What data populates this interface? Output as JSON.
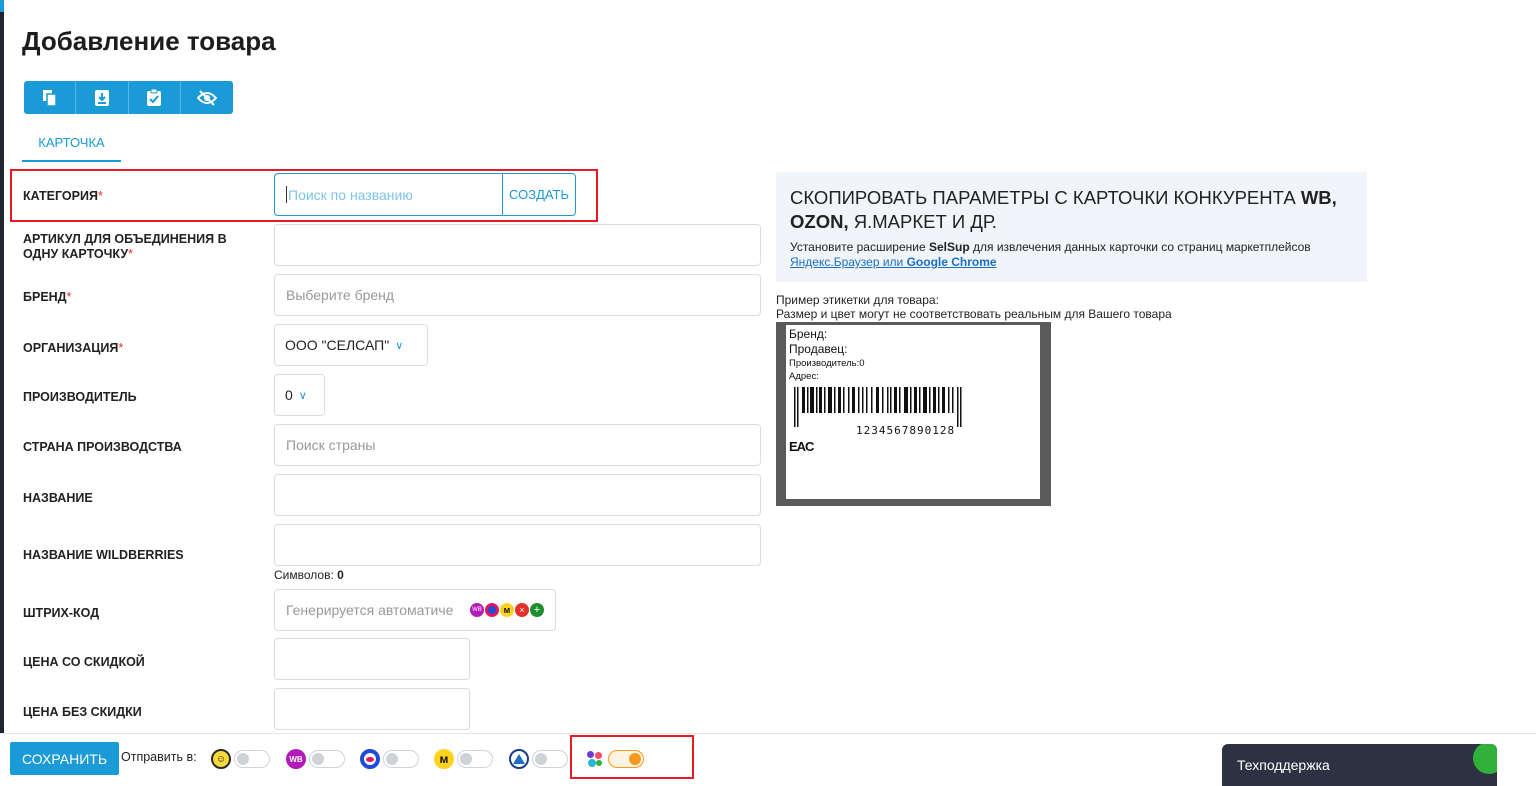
{
  "page": {
    "title": "Добавление товара"
  },
  "toolbar": {
    "icons": [
      "copy-icon",
      "download-icon",
      "clipboard-check-icon",
      "eye-off-icon"
    ]
  },
  "tabs": [
    {
      "label": "КАРТОЧКА",
      "active": true
    }
  ],
  "form": {
    "category": {
      "label": "КАТЕГОРИЯ",
      "required": "*",
      "placeholder": "Поиск по названию",
      "button": "СОЗДАТЬ"
    },
    "article": {
      "label_line1": "АРТИКУЛ ДЛЯ ОБЪЕДИНЕНИЯ В",
      "label_line2": "ОДНУ КАРТОЧКУ",
      "required": "*",
      "value": ""
    },
    "brand": {
      "label": "БРЕНД",
      "required": "*",
      "placeholder": "Выберите бренд"
    },
    "organization": {
      "label": "ОРГАНИЗАЦИЯ",
      "required": "*",
      "value": "ООО \"СЕЛСАП\""
    },
    "manufacturer": {
      "label": "ПРОИЗВОДИТЕЛЬ",
      "value": "0"
    },
    "country": {
      "label": "СТРАНА ПРОИЗВОДСТВА",
      "placeholder": "Поиск страны"
    },
    "name": {
      "label": "НАЗВАНИЕ",
      "value": ""
    },
    "wb_name": {
      "label": "НАЗВАНИЕ WILDBERRIES",
      "value": "",
      "chars_label": "Символов:",
      "chars_count": "0"
    },
    "barcode": {
      "label": "ШТРИХ-КОД",
      "placeholder": "Генерируется автоматиче"
    },
    "price_discount": {
      "label": "ЦЕНА СО СКИДКОЙ",
      "value": ""
    },
    "price_full": {
      "label": "ЦЕНА БЕЗ СКИДКИ",
      "value": ""
    }
  },
  "copy_card": {
    "title_part1": "СКОПИРОВАТЬ ПАРАМЕТРЫ С КАРТОЧКИ КОНКУРЕНТА ",
    "title_wb": "WB,",
    "title_ozon": "OZON,",
    "title_part2": " Я.МАРКЕТ И ДР.",
    "desc_part1": "Установите расширение ",
    "desc_brand": "SelSup",
    "desc_part2": " для извлечения данных карточки со страниц маркетплейсов",
    "link_part1": "Яндекс.Браузер или ",
    "link_part2": "Google Chrome"
  },
  "label_example": {
    "note_line1": "Пример этикетки для товара:",
    "note_line2": "Размер и цвет могут не соответствовать реальным для Вашего товара",
    "brand": "Бренд:",
    "seller": "Продавец:",
    "manufacturer": "Производитель:0",
    "address": "Адрес:",
    "barcode": "1234567890128",
    "eac": "EAC"
  },
  "bottom": {
    "save": "СОХРАНИТЬ",
    "send_to": "Отправить в:",
    "marketplaces": [
      {
        "icon": "smile-marketplace-icon",
        "on": false
      },
      {
        "icon": "wb-icon",
        "badge": "WB",
        "on": false
      },
      {
        "icon": "ozon-icon",
        "on": false
      },
      {
        "icon": "yandex-market-icon",
        "on": false
      },
      {
        "icon": "triangle-marketplace-icon",
        "on": false
      },
      {
        "icon": "dots-marketplace-icon",
        "on": true
      }
    ],
    "support": "Техподдержка"
  },
  "colors": {
    "accent": "#1a9ad6",
    "required": "#e0312b",
    "highlight": "#e51c23",
    "toggle_on": "#f39a1c"
  }
}
